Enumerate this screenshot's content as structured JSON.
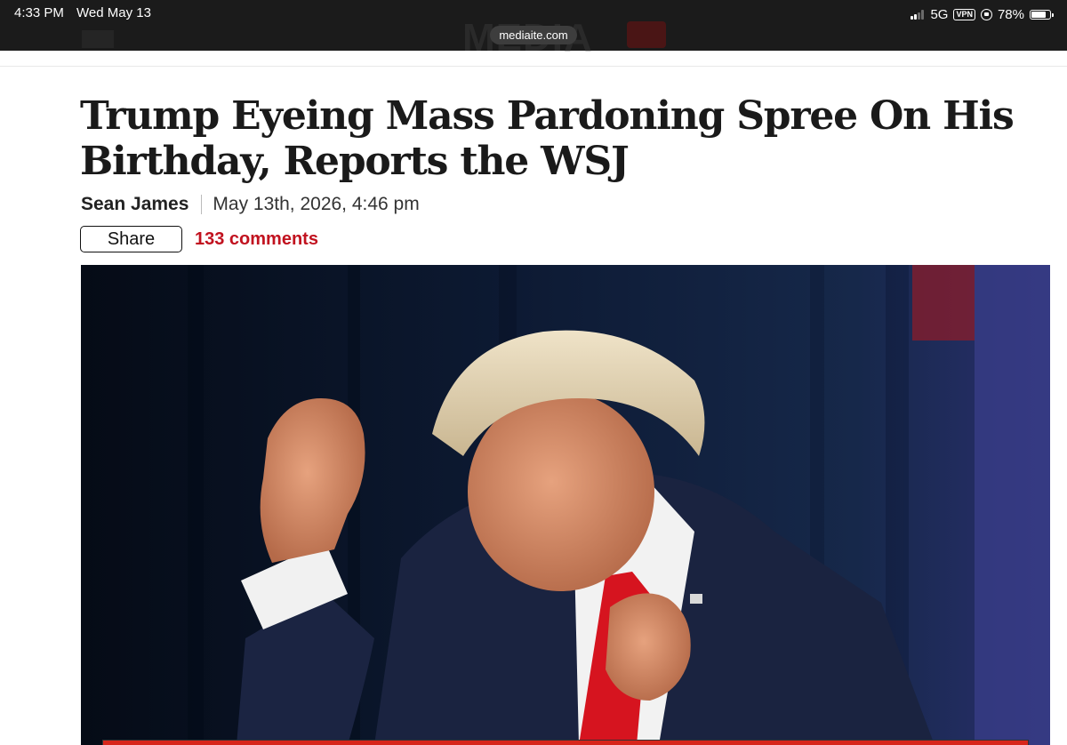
{
  "status_bar": {
    "time": "4:33 PM",
    "date": "Wed May 13",
    "network": "5G",
    "vpn": "VPN",
    "battery_percent": "78%",
    "battery_level": 0.78
  },
  "browser": {
    "url": "mediaite.com"
  },
  "article": {
    "headline": "Trump Eyeing Mass Pardoning Spree On His Birthday, Reports the WSJ",
    "author": "Sean James",
    "published": "May 13th, 2026, 4:46 pm",
    "share_label": "Share",
    "comments_label": "133 comments"
  },
  "colors": {
    "accent_red": "#c1121f",
    "status_bar_bg": "#1b1b1b",
    "photo_bg": "#0c1526"
  },
  "icons": [
    "signal-icon",
    "vpn-icon",
    "rotation-lock-icon",
    "battery-icon"
  ]
}
